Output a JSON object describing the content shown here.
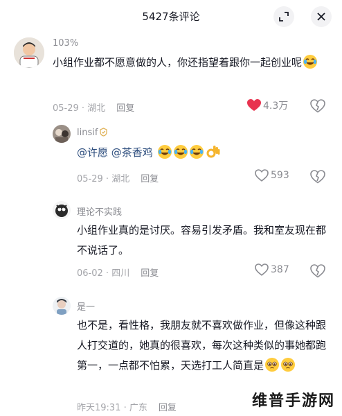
{
  "header": {
    "title": "5427条评论"
  },
  "comments": [
    {
      "user": "103%",
      "text": "小组作业都不愿意做的人，你还指望着跟你一起创业呢",
      "date": "05-29",
      "location": "湖北",
      "reply": "回复",
      "likes": "4.3万",
      "liked": true
    },
    {
      "user": "linsif",
      "mentions": [
        "@许愿",
        "@茶香鸡"
      ],
      "date": "05-29",
      "location": "湖北",
      "reply": "回复",
      "likes": "593"
    },
    {
      "user": "理论不实践",
      "text": "小组作业真的是讨厌。容易引发矛盾。我和室友现在都不说话了。",
      "date": "06-02",
      "location": "四川",
      "reply": "回复",
      "likes": "387"
    },
    {
      "user": "是一",
      "text": "也不是，看性格，我朋友就不喜欢做作业，但像这种跟人打交道的，她真的很喜欢，每次这种类似的事她都跑第一，一点都不怕累，天选打工人简直是",
      "date": "昨天19:31",
      "location": "广东",
      "reply": "回复"
    }
  ],
  "watermark": "维普手游网",
  "colors": {
    "like_red": "#fe2c55",
    "text": "#161823",
    "meta": "#a3a4a9"
  }
}
